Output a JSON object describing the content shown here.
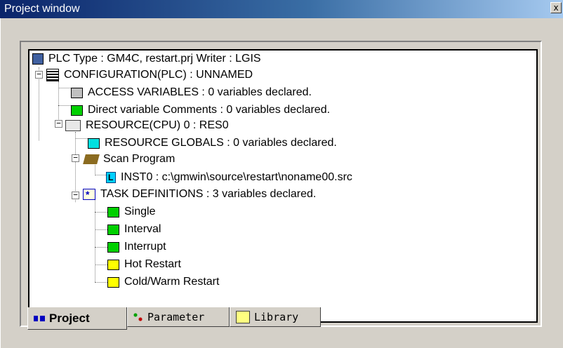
{
  "window": {
    "title": "Project window",
    "close_label": "x"
  },
  "tree": {
    "root": "PLC Type : GM4C, restart.prj       Writer : LGIS",
    "configuration": "CONFIGURATION(PLC) : UNNAMED",
    "access_variables": "ACCESS VARIABLES : 0 variables declared.",
    "direct_comments": "Direct variable Comments : 0 variables declared.",
    "resource": "RESOURCE(CPU) 0 : RES0",
    "resource_globals": "RESOURCE GLOBALS : 0 variables declared.",
    "scan_program": "Scan Program",
    "inst0": "INST0 : c:\\gmwin\\source\\restart\\noname00.src",
    "task_definitions": "TASK DEFINITIONS : 3 variables declared.",
    "tasks": [
      "Single",
      "Interval",
      "Interrupt",
      "Hot Restart",
      "Cold/Warm Restart"
    ]
  },
  "tabs": {
    "project": "Project",
    "parameter": "Parameter",
    "library": "Library"
  },
  "icons": {
    "access": "gray-folder-icon",
    "direct": "green-folder-icon",
    "globals": "cyan-folder-icon",
    "task_green": "green-folder-icon",
    "task_yellow": "yellow-folder-icon"
  }
}
